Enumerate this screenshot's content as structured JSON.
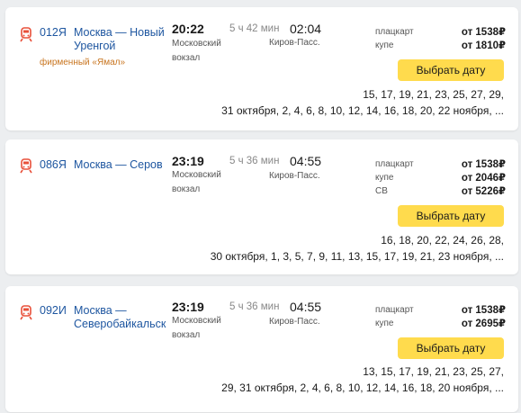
{
  "trains": [
    {
      "number": "012Я",
      "route": "Москва — Новый Уренгой",
      "brand": "фирменный «Ямал»",
      "departure_time": "20:22",
      "departure_station": "Московский вокзал",
      "duration": "5 ч 42 мин",
      "arrival_time": "02:04",
      "arrival_station": "Киров-Пасс.",
      "classes": [
        {
          "label": "плацкарт",
          "price": "от 1538₽"
        },
        {
          "label": "купе",
          "price": "от 1810₽"
        }
      ],
      "button_label": "Выбрать дату",
      "dates_line1": "15, 17, 19, 21, 23, 25, 27, 29,",
      "dates_line2": "31 октября, 2, 4, 6, 8, 10, 12, 14, 16, 18, 20, 22 ноября, ..."
    },
    {
      "number": "086Я",
      "route": "Москва — Серов",
      "departure_time": "23:19",
      "departure_station": "Московский вокзал",
      "duration": "5 ч 36 мин",
      "arrival_time": "04:55",
      "arrival_station": "Киров-Пасс.",
      "classes": [
        {
          "label": "плацкарт",
          "price": "от 1538₽"
        },
        {
          "label": "купе",
          "price": "от 2046₽"
        },
        {
          "label": "СВ",
          "price": "от 5226₽"
        }
      ],
      "button_label": "Выбрать дату",
      "dates_line1": "16, 18, 20, 22, 24, 26, 28,",
      "dates_line2": "30 октября, 1, 3, 5, 7, 9, 11, 13, 15, 17, 19, 21, 23 ноября, ..."
    },
    {
      "number": "092И",
      "route": "Москва — Северобайкальск",
      "departure_time": "23:19",
      "departure_station": "Московский вокзал",
      "duration": "5 ч 36 мин",
      "arrival_time": "04:55",
      "arrival_station": "Киров-Пасс.",
      "classes": [
        {
          "label": "плацкарт",
          "price": "от 1538₽"
        },
        {
          "label": "купе",
          "price": "от 2695₽"
        }
      ],
      "button_label": "Выбрать дату",
      "dates_line1": "13, 15, 17, 19, 21, 23, 25, 27,",
      "dates_line2": "29, 31 октября, 2, 4, 6, 8, 10, 12, 14, 16, 18, 20 ноября, ..."
    }
  ],
  "colors": {
    "link": "#1e56a0",
    "brand": "#c8741e",
    "button": "#ffdb4d",
    "icon": "#e8503a",
    "background": "#eceef0"
  },
  "icons": {
    "train": "train-icon"
  }
}
